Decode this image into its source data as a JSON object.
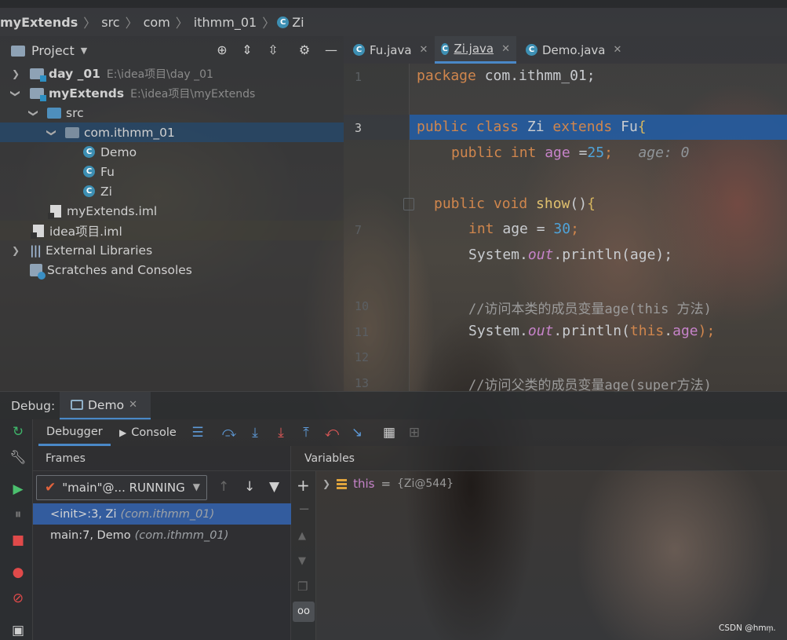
{
  "breadcrumb": {
    "items": [
      "myExtends",
      "src",
      "com",
      "ithmm_01",
      "Zi"
    ],
    "class_icon_letter": "C"
  },
  "project_panel": {
    "title": "Project",
    "tree": [
      {
        "label": "day _01",
        "path": "E:\\idea项目\\day _01",
        "type": "module",
        "expanded": false
      },
      {
        "label": "myExtends",
        "path": "E:\\idea项目\\myExtends",
        "type": "module",
        "expanded": true
      },
      {
        "label": "src",
        "type": "source-folder",
        "expanded": true
      },
      {
        "label": "com.ithmm_01",
        "type": "package",
        "expanded": true,
        "selected": true
      },
      {
        "label": "Demo",
        "type": "class-main"
      },
      {
        "label": "Fu",
        "type": "class"
      },
      {
        "label": "Zi",
        "type": "class"
      },
      {
        "label": "myExtends.iml",
        "type": "iml"
      },
      {
        "label": "idea项目.iml",
        "type": "iml"
      },
      {
        "label": "External Libraries",
        "type": "libraries",
        "expanded": false
      },
      {
        "label": "Scratches and Consoles",
        "type": "scratches"
      }
    ]
  },
  "editor": {
    "tabs": [
      {
        "label": "Fu.java",
        "active": false
      },
      {
        "label": "Zi.java",
        "active": true
      },
      {
        "label": "Demo.java",
        "active": false
      }
    ],
    "line_numbers": [
      "1",
      "3",
      "7",
      "10",
      "11",
      "12",
      "13"
    ],
    "current_line": "3",
    "code": {
      "l1_kw": "package ",
      "l1_rest": "com.ithmm_01;",
      "l3_kw": "public class ",
      "l3_name": "Zi ",
      "l3_kw2": "extends ",
      "l3_parent": "Fu",
      "l3_brace": "{",
      "l4_kw": "public int ",
      "l4_field": "age",
      "l4_eq": " =",
      "l4_num": "25",
      "l4_semi": ";",
      "l4_hint": "age: 0",
      "l6_kw": "public void ",
      "l6_fn": "show",
      "l6_paren": "()",
      "l6_brace": "{",
      "l7_kw": "int ",
      "l7_rest": "age = ",
      "l7_num": "30",
      "l7_semi": ";",
      "l8_a": "System.",
      "l8_out": "out",
      "l8_b": ".println(age);",
      "l10_cmt": "//访问本类的成员变量age(this 方法)",
      "l11_a": "System.",
      "l11_out": "out",
      "l11_b": ".println(",
      "l11_this": "this",
      "l11_dot": ".",
      "l11_fld": "age",
      "l11_end": ");",
      "l13_cmt": "//访问父类的成员变量age(super方法)"
    }
  },
  "debug": {
    "label": "Debug:",
    "session_tab": "Demo",
    "sub_tabs": [
      "Debugger",
      "Console"
    ],
    "frames_title": "Frames",
    "variables_title": "Variables",
    "thread": "\"main\"@... RUNNING",
    "frames": [
      {
        "method": "<init>:3, Zi",
        "pkg": "(com.ithmm_01)",
        "selected": true
      },
      {
        "method": "main:7, Demo",
        "pkg": "(com.ithmm_01)",
        "selected": false
      }
    ],
    "variables": [
      {
        "name": "this",
        "eq": "=",
        "value": "{Zi@544}"
      }
    ]
  },
  "watermark": "CSDN @hmm᷊.",
  "colors": {
    "accent": "#4a88c7",
    "selection": "#245da3",
    "keyword": "#d0864d",
    "number": "#4fa3d9",
    "field": "#c683c9",
    "function": "#e0c06e"
  }
}
